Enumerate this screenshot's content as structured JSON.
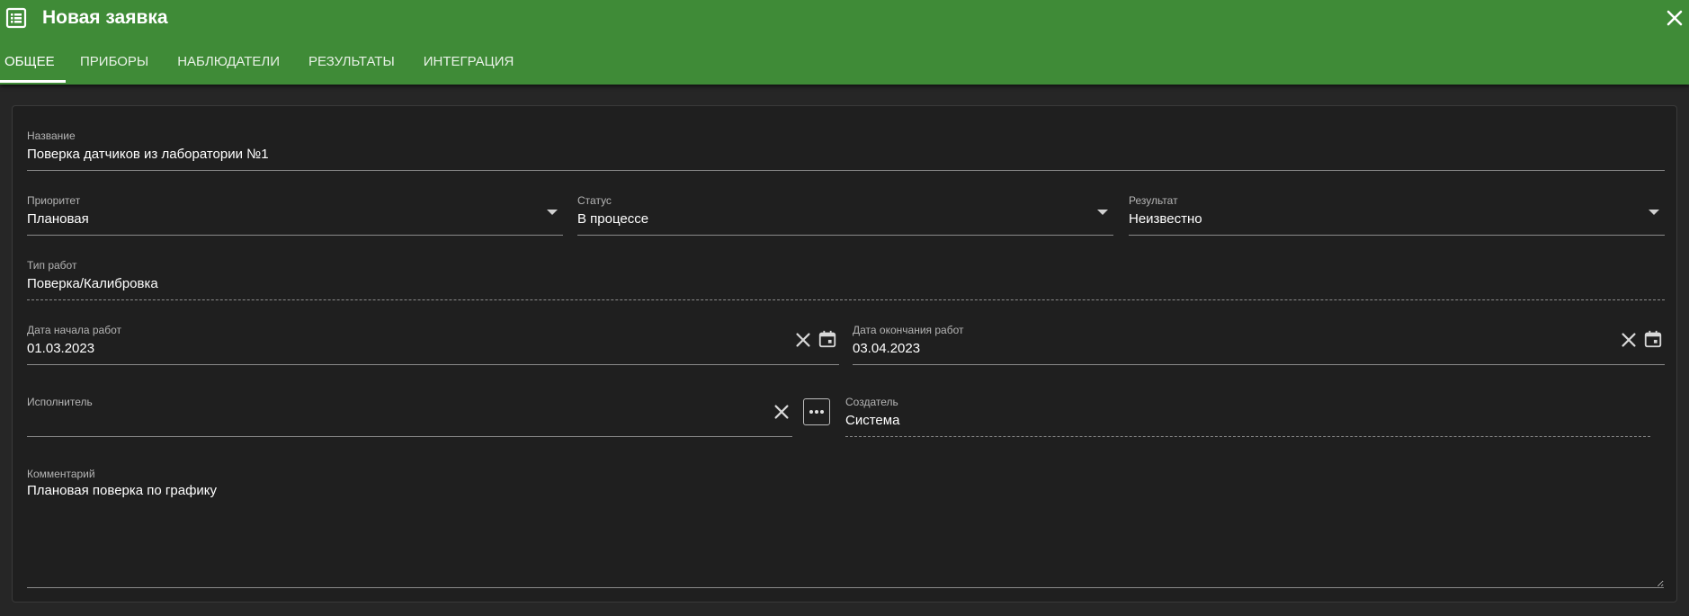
{
  "window": {
    "title": "Новая заявка",
    "icon": "list-icon",
    "accent_color": "#3f8b37"
  },
  "tabs": [
    {
      "label": "Общее",
      "active": true
    },
    {
      "label": "Приборы",
      "active": false
    },
    {
      "label": "Наблюдатели",
      "active": false
    },
    {
      "label": "Результаты",
      "active": false
    },
    {
      "label": "Интеграция",
      "active": false
    }
  ],
  "form": {
    "name": {
      "label": "Название",
      "value": "Поверка датчиков из лаборатории №1"
    },
    "priority": {
      "label": "Приоритет",
      "value": "Плановая"
    },
    "status": {
      "label": "Статус",
      "value": "В процессе"
    },
    "result": {
      "label": "Результат",
      "value": "Неизвестно"
    },
    "work_type": {
      "label": "Тип работ",
      "value": "Поверка/Калибровка"
    },
    "start_date": {
      "label": "Дата начала работ",
      "value": "01.03.2023"
    },
    "end_date": {
      "label": "Дата окончания работ",
      "value": "03.04.2023"
    },
    "executor": {
      "label": "Исполнитель",
      "value": ""
    },
    "creator": {
      "label": "Создатель",
      "value": "Система"
    },
    "comment": {
      "label": "Комментарий",
      "value": "Плановая поверка по графику"
    }
  }
}
